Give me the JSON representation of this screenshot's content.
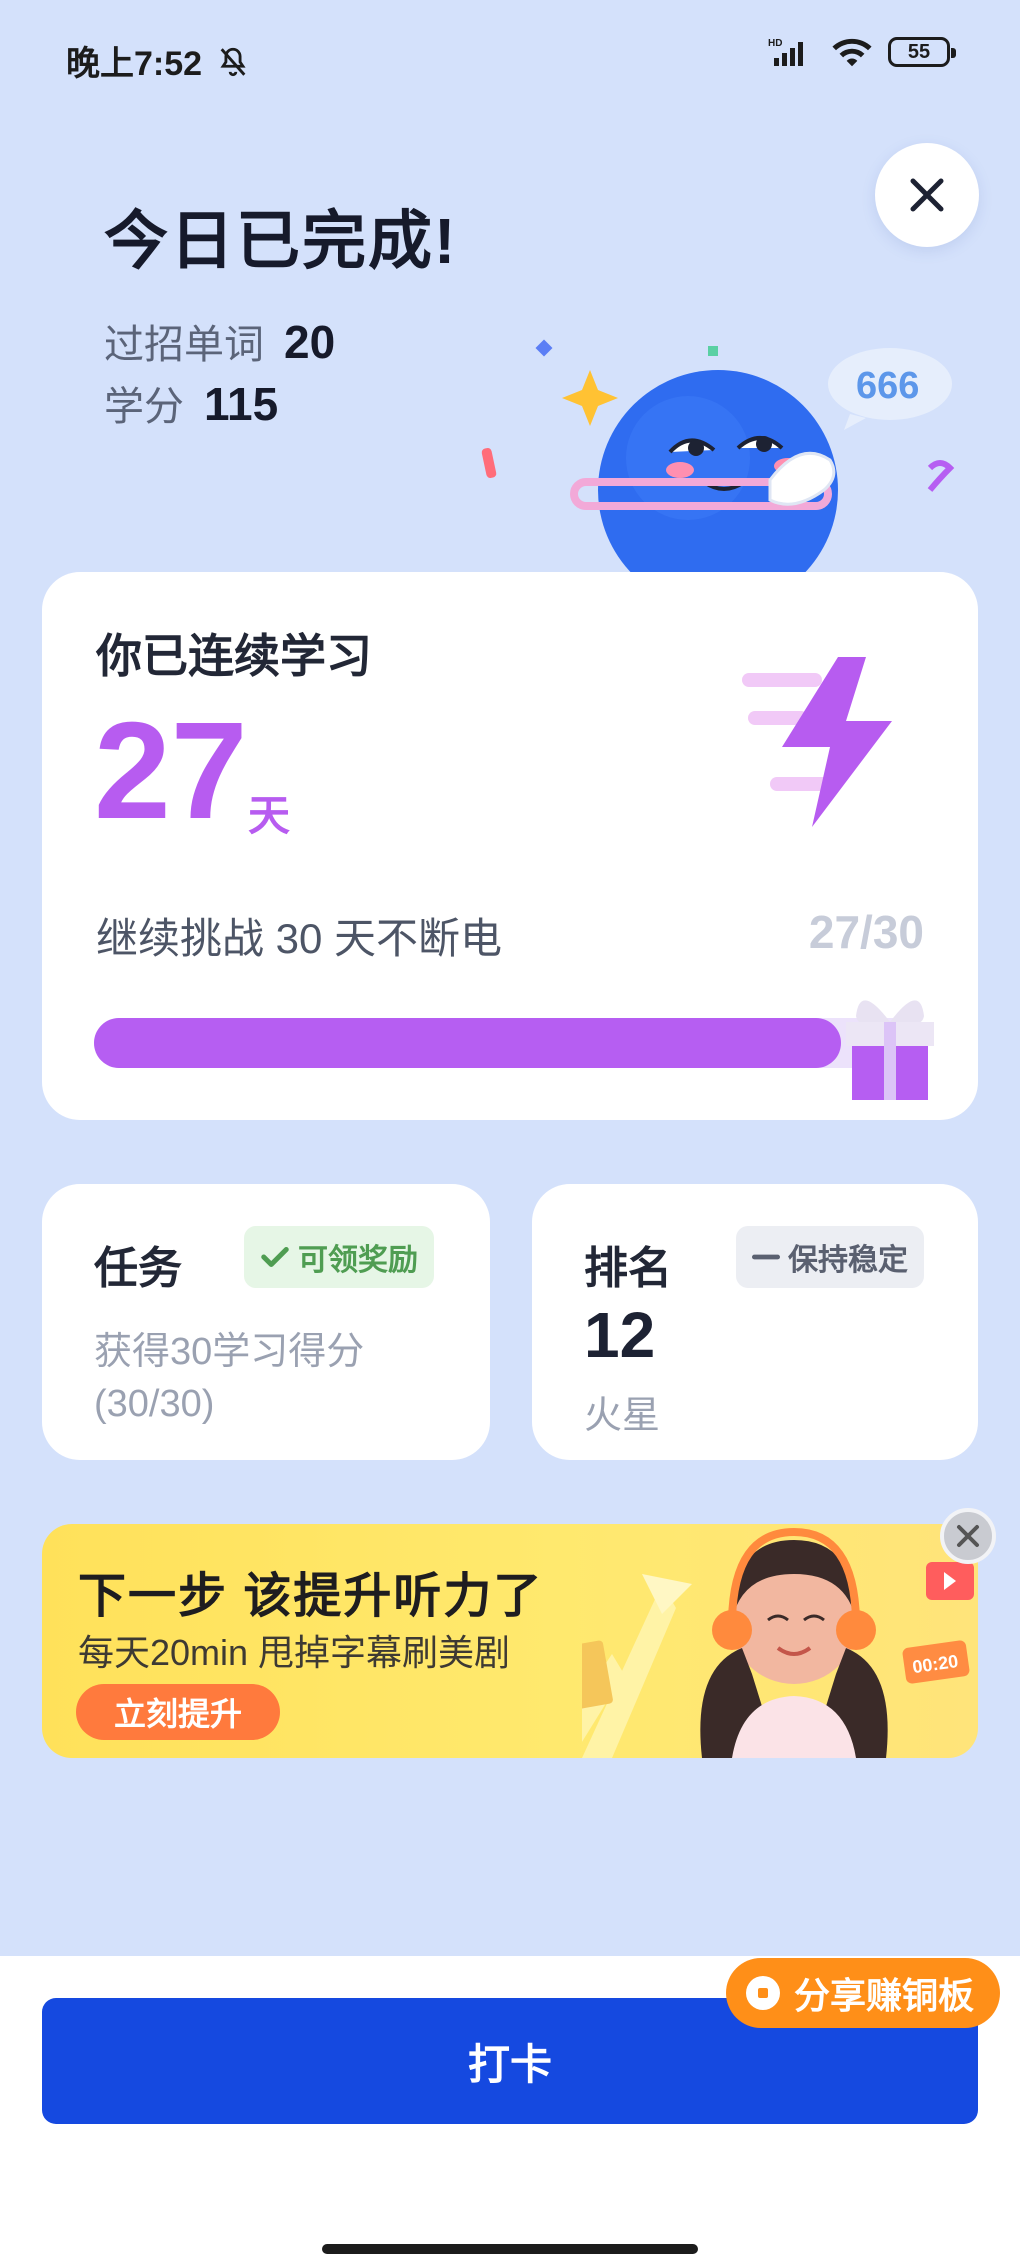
{
  "status_bar": {
    "time": "晚上7:52",
    "battery": "55",
    "icons": [
      "bell-off-icon",
      "hd-signal-icon",
      "wifi-icon",
      "battery-icon"
    ]
  },
  "header": {
    "title": "今日已完成!",
    "words_label": "过招单词",
    "words_value": "20",
    "credits_label": "学分",
    "credits_value": "115",
    "mascot_bubble": "666"
  },
  "streak": {
    "title": "你已连续学习",
    "days": "27",
    "unit": "天",
    "challenge": "继续挑战 30 天不断电",
    "progress_text": "27/30",
    "progress_fraction": 0.9
  },
  "task": {
    "title": "任务",
    "badge": "可领奖励",
    "desc_line1": "获得30学习得分",
    "desc_line2": "(30/30)"
  },
  "rank": {
    "title": "排名",
    "badge": "保持稳定",
    "value": "12",
    "label": "火星"
  },
  "banner": {
    "title": "下一步 该提升听力了",
    "subtitle": "每天20min 甩掉字幕刷美剧",
    "button": "立刻提升",
    "timer": "00:20"
  },
  "share": {
    "label": "分享赚铜板"
  },
  "checkin": {
    "label": "打卡"
  },
  "colors": {
    "background": "#d4e1fb",
    "accent_purple": "#b65ef2",
    "primary_blue": "#1549e0",
    "share_orange": "#ff8f18",
    "banner_yellow": "#ffe15a"
  }
}
